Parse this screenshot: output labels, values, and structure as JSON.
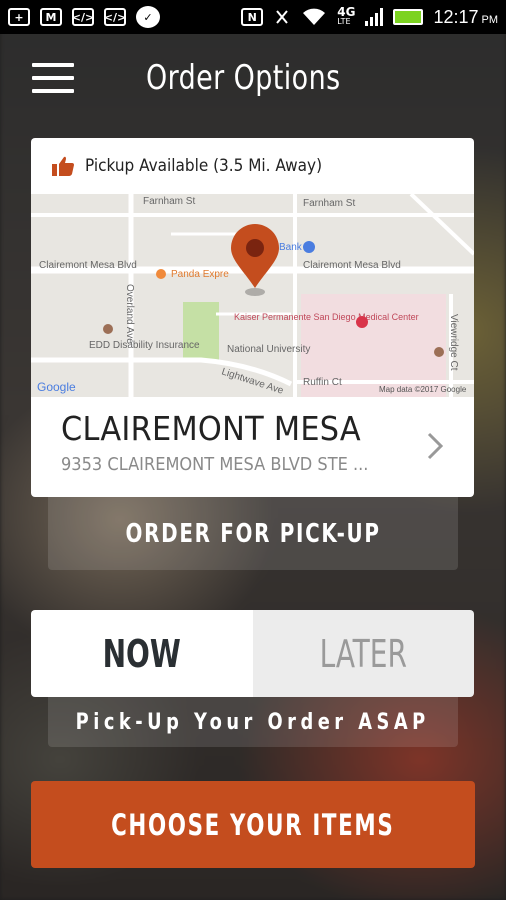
{
  "status_bar": {
    "time": "12:17",
    "ampm": "PM",
    "network": "4G",
    "network_sub": "LTE",
    "icons": [
      "plus-icon",
      "gmail-icon",
      "code-icon",
      "code-icon",
      "chat-icon",
      "nfc-icon",
      "mute-icon",
      "wifi-icon",
      "signal-icon",
      "battery-icon"
    ]
  },
  "header": {
    "title": "Order Options",
    "menu_icon": "hamburger-menu-icon"
  },
  "location_card": {
    "pickup_status": "Pickup Available (3.5 Mi. Away)",
    "status_icon": "thumbs-up-icon",
    "store_name": "CLAIREMONT MESA",
    "store_address": "9353 CLAIREMONT MESA BLVD STE ...",
    "map": {
      "streets": [
        "Farnham St",
        "Farnham St",
        "Clairemont Mesa Blvd",
        "Clairemont Mesa Blvd",
        "Overland Ave",
        "Viewridge Ct",
        "Lightwave Ave",
        "Ruffin Ct"
      ],
      "places": [
        "Panda Expre",
        "Bank",
        "Kaiser Permanente San Diego Medical Center",
        "EDD Disability Insurance",
        "National University"
      ],
      "logo": "Google",
      "attribution": "Map data ©2017 Google"
    }
  },
  "order_type_button": "ORDER FOR PICK-UP",
  "timing_toggle": {
    "now": "NOW",
    "later": "LATER",
    "selected": "NOW"
  },
  "timing_description": "Pick-Up Your Order ASAP",
  "cta_button": "CHOOSE YOUR ITEMS",
  "colors": {
    "accent": "#c44d1e",
    "status_battery": "#7cd321",
    "map_pin": "#c44d1e"
  }
}
